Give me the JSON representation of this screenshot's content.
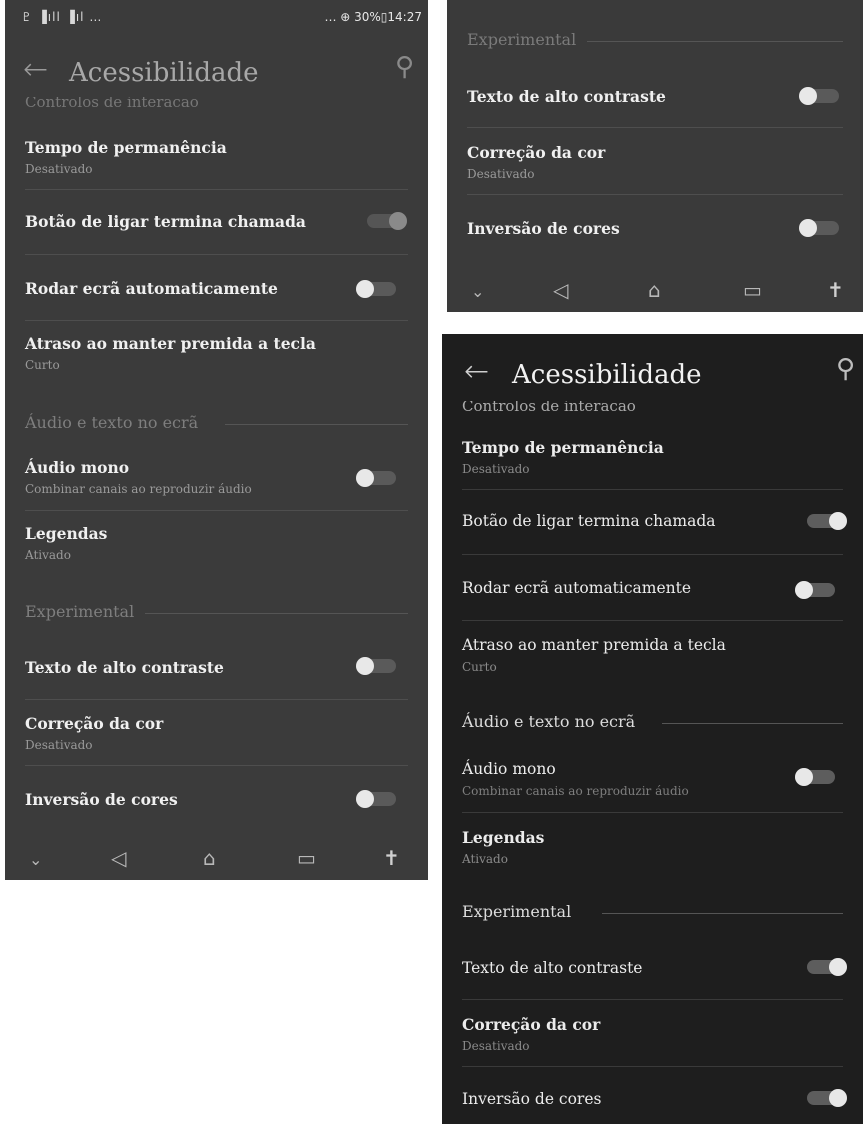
{
  "status": {
    "left": "♇ ▐ıll ▐ıl  …",
    "right": "… ⊕ 30%▯14:27"
  },
  "app": {
    "back_icon": "←",
    "title": "Acessibilidade",
    "search_icon": "⚲",
    "cut_header": "Controlos de interação"
  },
  "items": {
    "tempo": {
      "title": "Tempo de permanência",
      "sub": "Desativado"
    },
    "botao": {
      "title": "Botão de ligar termina chamada"
    },
    "rodar": {
      "title": "Rodar ecrã automaticamente"
    },
    "atraso": {
      "title": "Atraso ao manter premida a tecla",
      "sub": "Curto"
    },
    "audio_section": "Áudio e texto no ecrã",
    "audio_mono": {
      "title": "Áudio mono",
      "sub": "Combinar canais ao reproduzir áudio"
    },
    "legendas": {
      "title": "Legendas",
      "sub": "Ativado"
    },
    "experimental_section": "Experimental",
    "alto_contraste": {
      "title": "Texto de alto contraste"
    },
    "correcao": {
      "title": "Correção da cor",
      "sub": "Desativado"
    },
    "inversao": {
      "title": "Inversão de cores"
    }
  },
  "nav": {
    "down": "⌄",
    "back": "◁",
    "home": "⌂",
    "recent": "▭",
    "accessibility": "ᾜd"
  },
  "toggles": {
    "panel1": {
      "botao": "on-disabled",
      "rodar": "off",
      "audio_mono": "off",
      "alto_contraste": "off",
      "inversao": "off"
    },
    "panel2": {
      "alto_contraste": "off",
      "inversao": "off"
    },
    "panel3": {
      "botao": "on",
      "rodar": "off",
      "audio_mono": "off",
      "alto_contraste": "on",
      "inversao": "on"
    }
  },
  "colors": {
    "panel1_bg": "#3b3b3b",
    "panel2_bg": "#3a3a3a",
    "panel3_bg": "#1e1e1e"
  }
}
